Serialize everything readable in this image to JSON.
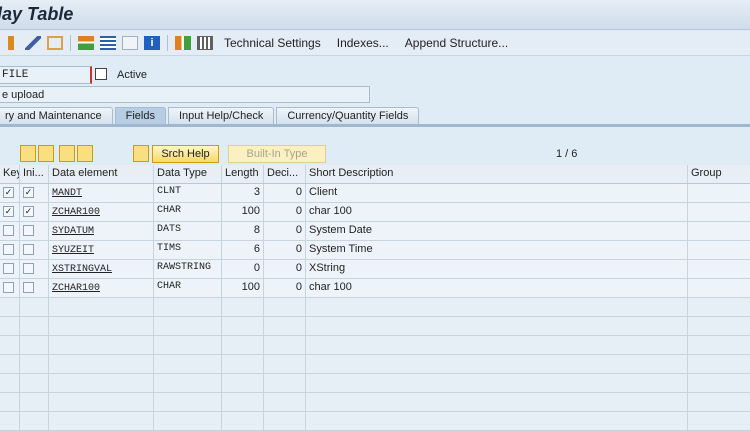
{
  "title": "play Table",
  "toolbar": {
    "items": [
      "Technical Settings",
      "Indexes...",
      "Append Structure..."
    ]
  },
  "table_name": "FILE",
  "status": "Active",
  "short_text": "e upload",
  "tabs": [
    "ry and Maintenance",
    "Fields",
    "Input Help/Check",
    "Currency/Quantity Fields"
  ],
  "buttons": {
    "srch_help": "Srch Help",
    "builtin": "Built-In Type"
  },
  "pager": "1  /  6",
  "columns": [
    "Key",
    "Ini...",
    "Data element",
    "Data Type",
    "Length",
    "Deci...",
    "Short Description",
    "Group"
  ],
  "rows": [
    {
      "key": true,
      "ini": true,
      "element": "MANDT",
      "type": "CLNT",
      "length": "3",
      "dec": "0",
      "desc": "Client"
    },
    {
      "key": true,
      "ini": true,
      "element": "ZCHAR100",
      "type": "CHAR",
      "length": "100",
      "dec": "0",
      "desc": "char 100"
    },
    {
      "key": false,
      "ini": false,
      "element": "SYDATUM",
      "type": "DATS",
      "length": "8",
      "dec": "0",
      "desc": "System Date"
    },
    {
      "key": false,
      "ini": false,
      "element": "SYUZEIT",
      "type": "TIMS",
      "length": "6",
      "dec": "0",
      "desc": "System Time"
    },
    {
      "key": false,
      "ini": false,
      "element": "XSTRINGVAL",
      "type": "RAWSTRING",
      "length": "0",
      "dec": "0",
      "desc": "XString"
    },
    {
      "key": false,
      "ini": false,
      "element": "ZCHAR100",
      "type": "CHAR",
      "length": "100",
      "dec": "0",
      "desc": "char 100"
    }
  ]
}
